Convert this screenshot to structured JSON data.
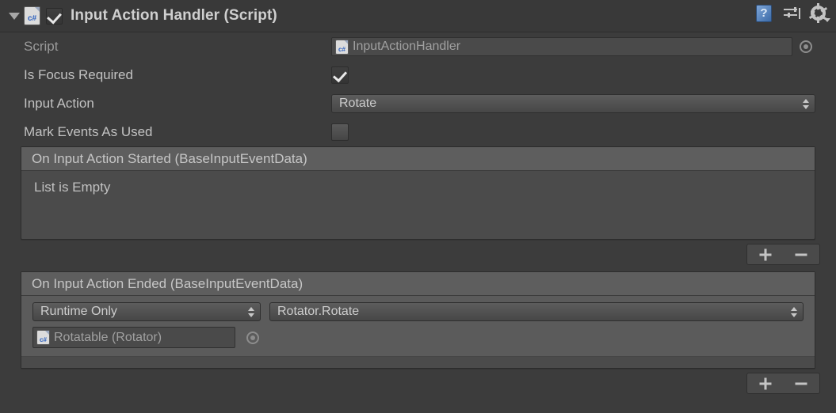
{
  "component": {
    "title": "Input Action Handler (Script)",
    "enabled": true,
    "foldout_icon": "triangle-down-icon",
    "script_type_icon": "csharp-script-icon",
    "header_icons": [
      {
        "name": "help-icon",
        "label": "?"
      },
      {
        "name": "preset-icon",
        "label": ""
      },
      {
        "name": "settings-gear-icon",
        "label": ""
      }
    ]
  },
  "properties": {
    "script": {
      "label": "Script",
      "value": "InputActionHandler",
      "icon": "csharp-script-icon",
      "picker_icon": "object-picker-icon"
    },
    "is_focus_required": {
      "label": "Is Focus Required",
      "checked": true
    },
    "input_action": {
      "label": "Input Action",
      "value": "Rotate",
      "dropdown_icon": "updown-arrows-icon"
    },
    "mark_events_as_used": {
      "label": "Mark Events As Used",
      "checked": false
    }
  },
  "events": [
    {
      "header": "On Input Action Started (BaseInputEventData)",
      "empty_text": "List is Empty",
      "entries": [],
      "add_label": "+",
      "remove_label": "–"
    },
    {
      "header": "On Input Action Ended (BaseInputEventData)",
      "empty_text": "",
      "entries": [
        {
          "call_state": "Runtime Only",
          "method": "Rotator.Rotate",
          "target_object": "Rotatable (Rotator)",
          "target_icon": "csharp-script-icon",
          "picker_icon": "object-picker-icon"
        }
      ],
      "add_label": "+",
      "remove_label": "–"
    }
  ],
  "colors": {
    "background": "#3c3c3c",
    "header": "#393939",
    "panel_body": "#4b4b4b",
    "panel_header": "#5e5e5e",
    "entry_row": "#5b5b5b",
    "text": "#c2c2c2",
    "text_dim": "#9a9a9a",
    "accent_blue": "#3c6ba8"
  }
}
